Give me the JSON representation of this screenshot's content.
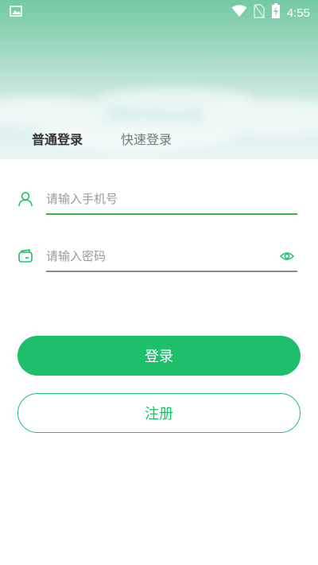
{
  "status_bar": {
    "time": "4:55",
    "icons": [
      "image-icon",
      "wifi-icon",
      "no-sim-icon",
      "battery-charging-icon"
    ]
  },
  "tabs": [
    {
      "label": "普通登录",
      "active": true
    },
    {
      "label": "快速登录",
      "active": false
    }
  ],
  "form": {
    "phone_placeholder": "请输入手机号",
    "phone_value": "",
    "password_placeholder": "请输入密码",
    "password_value": "",
    "phone_icon": "user-icon",
    "password_icon": "wallet-lock-icon",
    "eye_icon": "eye-icon"
  },
  "buttons": {
    "login_label": "登录",
    "register_label": "注册"
  },
  "colors": {
    "accent": "#1dbf6a",
    "active_line": "#3cb44a",
    "inactive_line": "#8a8a8a"
  }
}
